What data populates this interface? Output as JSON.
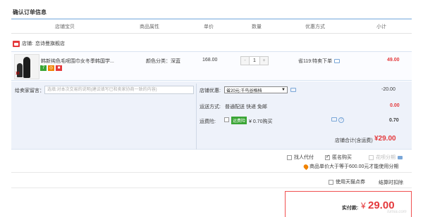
{
  "page": {
    "title": "确认订单信息"
  },
  "table_headers": [
    "店铺宝贝",
    "商品属性",
    "单价",
    "数量",
    "优惠方式",
    "小计"
  ],
  "shop": {
    "label": "店铺:",
    "name": "恋诗曼旗舰店"
  },
  "item": {
    "name": "韩新纯色毛呢围巾女冬季韩国学...",
    "thumb_text": "10",
    "badges": [
      {
        "text": "7",
        "color": "#3aa535"
      },
      {
        "text": "◎",
        "color": "#f08200"
      },
      {
        "text": "■",
        "color": "#e4393c"
      }
    ],
    "attribute": "颜色分类：深蓝",
    "price": "168.00",
    "quantity": "1",
    "qty_minus": "-",
    "qty_plus": "+",
    "promo": "省119:特卖下单",
    "subtotal": "49.00"
  },
  "message": {
    "label": "给卖家留言：",
    "placeholder": "选填:对本次交易的说明(建议填写已和卖家协商一致的内容)"
  },
  "shop_discount": {
    "label": "店铺优惠:",
    "selected": "省20元:千鸟谷格档",
    "amount": "-20.00"
  },
  "shipping": {
    "label": "运送方式:",
    "method": "普通配送 快递 免邮",
    "cost": "0.00"
  },
  "insurance": {
    "label": "运费险:",
    "tag": "运费险",
    "price": "¥ 0.70购买",
    "amount": "0.70",
    "help_icon": "?"
  },
  "shop_total": {
    "label": "店铺合计(含运费)",
    "amount": "¥29.00"
  },
  "options": {
    "proxy_pay": "找人代付",
    "anonymous": "匿名购买",
    "huabei": "花呗分期",
    "huabei_tip": "商品单价大于等于600.00元才能使用分期"
  },
  "tmall_points": "使用天猫点券",
  "settle": "结算时扣除",
  "payment": {
    "label": "实付款:",
    "symbol": "¥",
    "amount": "29.00"
  },
  "watermark": "Iumia.com",
  "colors": {
    "accent_red": "#e4393c",
    "link_blue": "#7aa7d8",
    "row_bg": "#eef2fa"
  }
}
